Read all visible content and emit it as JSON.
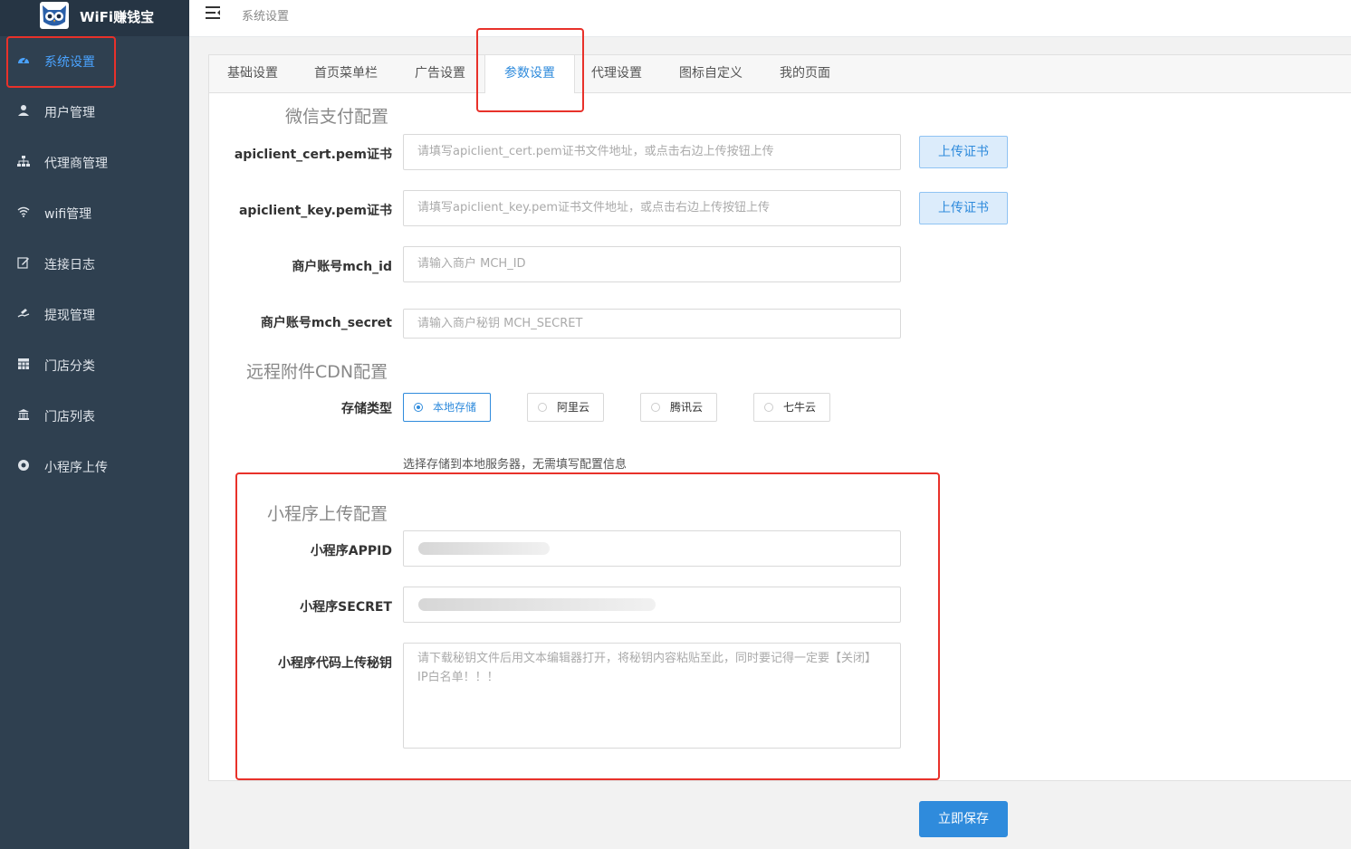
{
  "app": {
    "title": "WiFi赚钱宝"
  },
  "sidebar": {
    "items": [
      {
        "label": "系统设置",
        "icon": "dashboard-icon"
      },
      {
        "label": "用户管理",
        "icon": "user-icon"
      },
      {
        "label": "代理商管理",
        "icon": "sitemap-icon"
      },
      {
        "label": "wifi管理",
        "icon": "wifi-icon"
      },
      {
        "label": "连接日志",
        "icon": "edit-log-icon"
      },
      {
        "label": "提现管理",
        "icon": "withdraw-icon"
      },
      {
        "label": "门店分类",
        "icon": "grid-icon"
      },
      {
        "label": "门店列表",
        "icon": "store-icon"
      },
      {
        "label": "小程序上传",
        "icon": "upload-circle-icon"
      }
    ]
  },
  "topbar": {
    "breadcrumb": "系统设置"
  },
  "tabs": [
    {
      "label": "基础设置"
    },
    {
      "label": "首页菜单栏"
    },
    {
      "label": "广告设置"
    },
    {
      "label": "参数设置"
    },
    {
      "label": "代理设置"
    },
    {
      "label": "图标自定义"
    },
    {
      "label": "我的页面"
    }
  ],
  "wechat_pay": {
    "title": "微信支付配置",
    "cert": {
      "label": "apiclient_cert.pem证书",
      "placeholder": "请填写apiclient_cert.pem证书文件地址，或点击右边上传按钮上传",
      "button": "上传证书"
    },
    "key": {
      "label": "apiclient_key.pem证书",
      "placeholder": "请填写apiclient_key.pem证书文件地址，或点击右边上传按钮上传",
      "button": "上传证书"
    },
    "mch_id": {
      "label": "商户账号mch_id",
      "placeholder": "请输入商户 MCH_ID"
    },
    "mch_secret": {
      "label": "商户账号mch_secret",
      "placeholder": "请输入商户秘钥 MCH_SECRET"
    }
  },
  "cdn": {
    "title": "远程附件CDN配置",
    "storage_label": "存储类型",
    "options": [
      {
        "label": "本地存储",
        "checked": true
      },
      {
        "label": "阿里云",
        "checked": false
      },
      {
        "label": "腾讯云",
        "checked": false
      },
      {
        "label": "七牛云",
        "checked": false
      }
    ],
    "hint": "选择存储到本地服务器，无需填写配置信息"
  },
  "miniprogram": {
    "title": "小程序上传配置",
    "appid": {
      "label": "小程序APPID"
    },
    "secret": {
      "label": "小程序SECRET"
    },
    "upload_key": {
      "label": "小程序代码上传秘钥",
      "placeholder": "请下载秘钥文件后用文本编辑器打开，将秘钥内容粘贴至此，同时要记得一定要【关闭】IP白名单！！！"
    }
  },
  "save_button": "立即保存",
  "colors": {
    "sidebar": "#2f4050",
    "accent": "#2f8bdc",
    "highlight": "#e8312a"
  }
}
